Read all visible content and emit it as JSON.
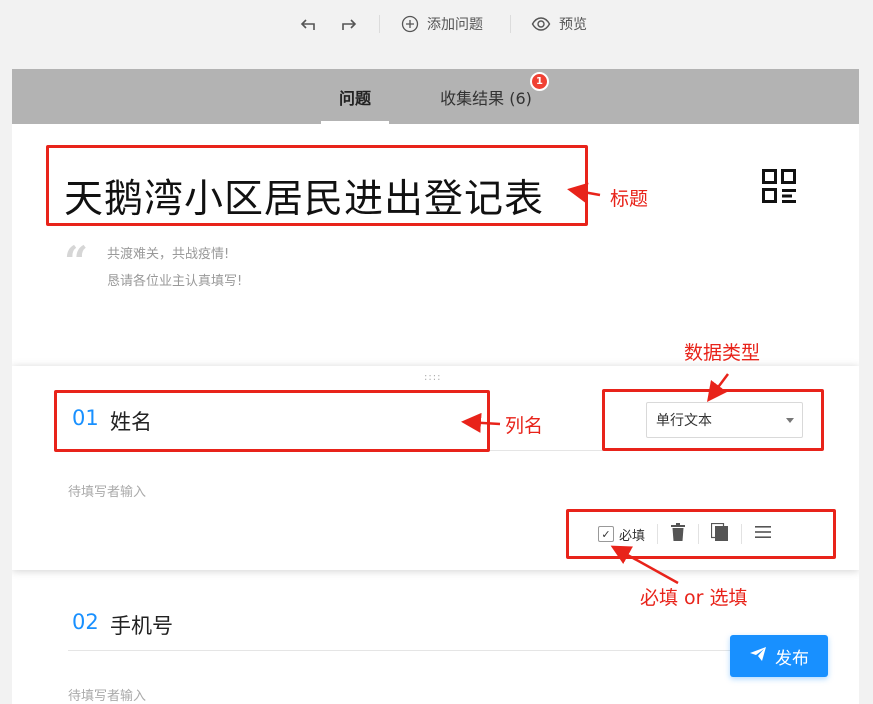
{
  "toolbar": {
    "undo_icon": "undo-icon",
    "redo_icon": "redo-icon",
    "add_question_label": "添加问题",
    "add_question_icon": "plus-circle-icon",
    "preview_label": "预览",
    "preview_icon": "eye-icon"
  },
  "tabs": [
    {
      "label": "问题",
      "active": true
    },
    {
      "label": "收集结果 (6)",
      "active": false,
      "badge": "1"
    }
  ],
  "form": {
    "title": "天鹅湾小区居民进出登记表",
    "qr_icon": "qr-code-icon",
    "description": [
      "共渡难关，共战疫情!",
      "恳请各位业主认真填写!"
    ]
  },
  "questions": [
    {
      "number": "01",
      "label": "姓名",
      "placeholder": "待填写者输入",
      "type": "单行文本",
      "required_label": "必填",
      "required": true,
      "selected": true
    },
    {
      "number": "02",
      "label": "手机号",
      "placeholder": "待填写者输入"
    }
  ],
  "annotations": {
    "title": "标题",
    "data_type": "数据类型",
    "column_name": "列名",
    "required_or_optional": "必填 or 选填"
  },
  "publish_label": "发布",
  "colors": {
    "accent": "#1890ff",
    "annotation": "#e8231a",
    "badge": "#f04134",
    "tabbar": "#b3b3b3"
  }
}
